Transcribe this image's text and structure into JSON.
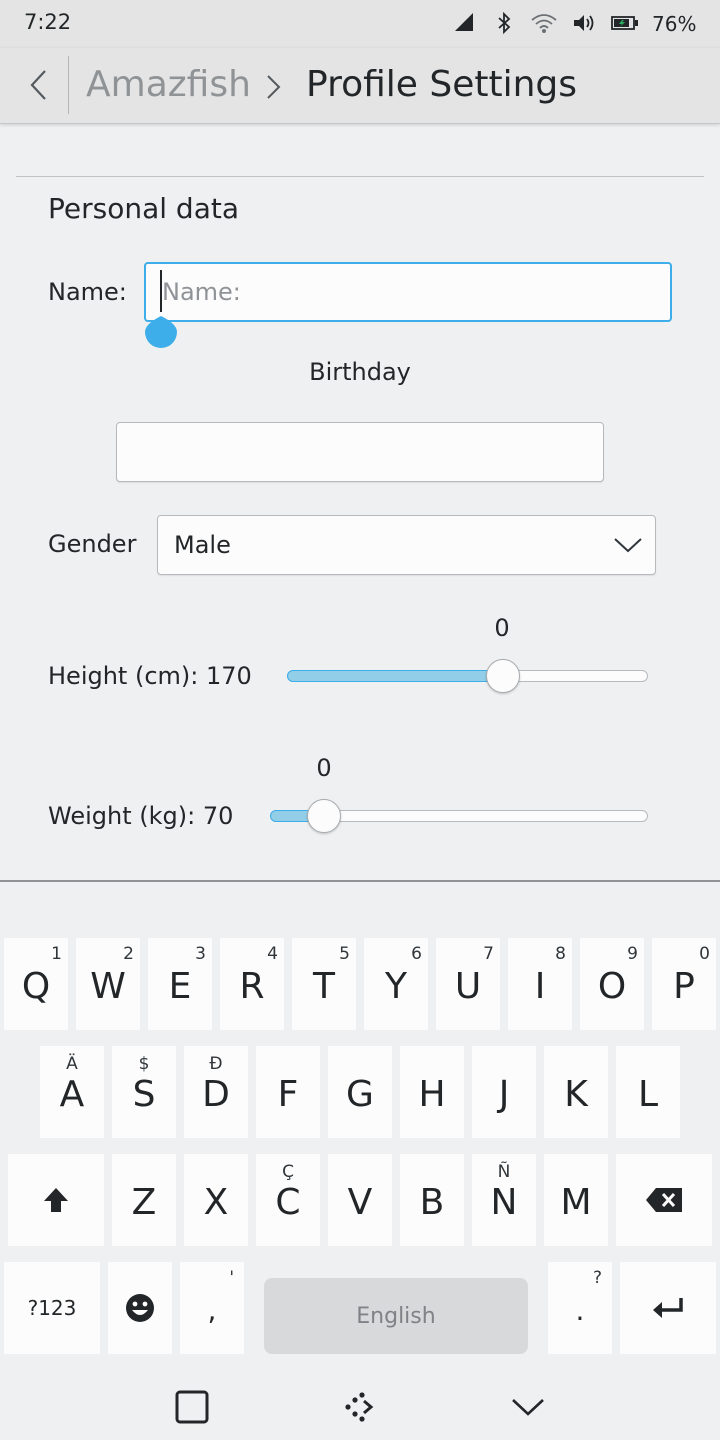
{
  "status_bar": {
    "time": "7:22",
    "battery_percent": "76%",
    "icons": [
      "signal-icon",
      "bluetooth-icon",
      "wifi-icon",
      "volume-icon",
      "battery-icon"
    ]
  },
  "header": {
    "breadcrumb_parent": "Amazfish",
    "title": "Profile Settings"
  },
  "personal_data": {
    "section_title": "Personal data",
    "name_label": "Name:",
    "name_placeholder": "Name:",
    "name_value": "",
    "birthday_label": "Birthday",
    "birthday_value": "",
    "gender_label": "Gender",
    "gender_value": "Male",
    "height": {
      "label": "Height (cm): 170",
      "tooltip_value": "0",
      "position_fraction": 0.598
    },
    "weight": {
      "label": "Weight (kg): 70",
      "tooltip_value": "0",
      "position_fraction": 0.143
    }
  },
  "keyboard": {
    "row1": [
      {
        "key": "Q",
        "alt": "1"
      },
      {
        "key": "W",
        "alt": "2"
      },
      {
        "key": "E",
        "alt": "3"
      },
      {
        "key": "R",
        "alt": "4"
      },
      {
        "key": "T",
        "alt": "5"
      },
      {
        "key": "Y",
        "alt": "6"
      },
      {
        "key": "U",
        "alt": "7"
      },
      {
        "key": "I",
        "alt": "8"
      },
      {
        "key": "O",
        "alt": "9"
      },
      {
        "key": "P",
        "alt": "0"
      }
    ],
    "row2": [
      {
        "key": "A",
        "alt": "Ä"
      },
      {
        "key": "S",
        "alt": "$"
      },
      {
        "key": "D",
        "alt": "Đ"
      },
      {
        "key": "F",
        "alt": ""
      },
      {
        "key": "G",
        "alt": ""
      },
      {
        "key": "H",
        "alt": ""
      },
      {
        "key": "J",
        "alt": ""
      },
      {
        "key": "K",
        "alt": ""
      },
      {
        "key": "L",
        "alt": ""
      }
    ],
    "row3": [
      {
        "key": "Z",
        "alt": ""
      },
      {
        "key": "X",
        "alt": ""
      },
      {
        "key": "C",
        "alt": "Ç"
      },
      {
        "key": "V",
        "alt": ""
      },
      {
        "key": "B",
        "alt": ""
      },
      {
        "key": "N",
        "alt": "Ñ"
      },
      {
        "key": "M",
        "alt": ""
      }
    ],
    "symbols_label": "?123",
    "comma_label": ",",
    "comma_alt": "'",
    "space_label": "English",
    "period_label": ".",
    "period_alt": "?",
    "shift_icon": "shift-icon",
    "backspace_icon": "backspace-icon",
    "emoji_icon": "emoji-icon",
    "enter_icon": "enter-icon"
  },
  "nav_bar": {
    "icons": [
      "overview-square-icon",
      "switch-keyboard-icon",
      "hide-keyboard-chevron-icon"
    ]
  },
  "colors": {
    "accent": "#3daee9",
    "slider_fill": "#93cee9",
    "background": "#eff0f1",
    "header_bg": "#e4e4e4"
  }
}
